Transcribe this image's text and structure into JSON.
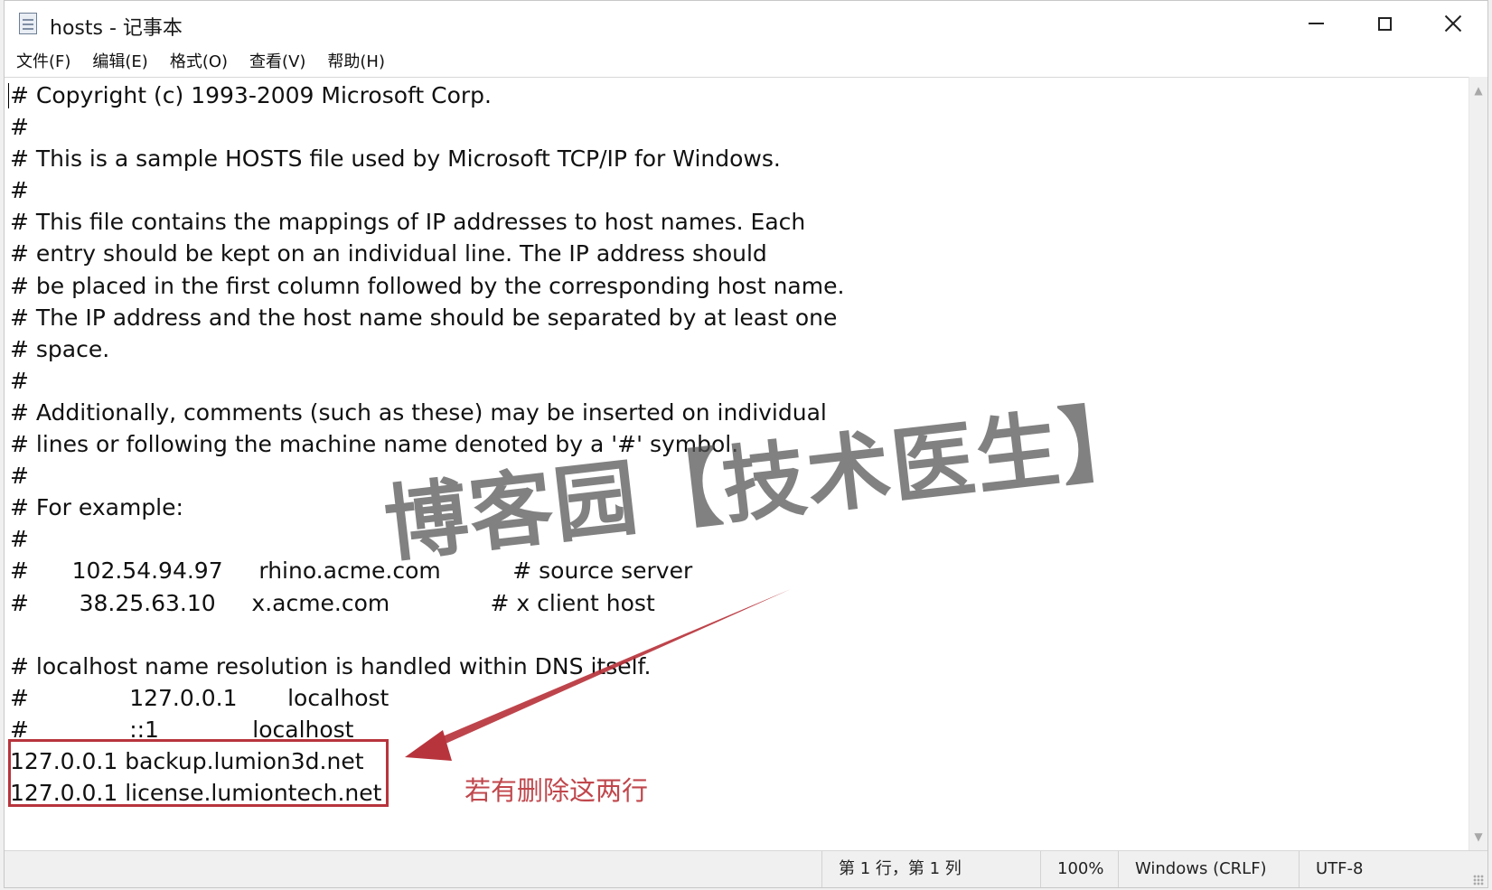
{
  "window": {
    "title": "hosts - 记事本",
    "controls": {
      "minimize": "minimize",
      "maximize": "maximize",
      "close": "close"
    }
  },
  "menu": [
    {
      "label": "文件(F)"
    },
    {
      "label": "编辑(E)"
    },
    {
      "label": "格式(O)"
    },
    {
      "label": "查看(V)"
    },
    {
      "label": "帮助(H)"
    }
  ],
  "editor": {
    "lines": [
      "# Copyright (c) 1993-2009 Microsoft Corp.",
      "#",
      "# This is a sample HOSTS file used by Microsoft TCP/IP for Windows.",
      "#",
      "# This file contains the mappings of IP addresses to host names. Each",
      "# entry should be kept on an individual line. The IP address should",
      "# be placed in the first column followed by the corresponding host name.",
      "# The IP address and the host name should be separated by at least one",
      "# space.",
      "#",
      "# Additionally, comments (such as these) may be inserted on individual",
      "# lines or following the machine name denoted by a '#' symbol.",
      "#",
      "# For example:",
      "#",
      "#      102.54.94.97     rhino.acme.com          # source server",
      "#       38.25.63.10     x.acme.com              # x client host",
      "",
      "# localhost name resolution is handled within DNS itself.",
      "#              127.0.0.1       localhost",
      "#              ::1             localhost",
      "127.0.0.1 backup.lumion3d.net",
      "127.0.0.1 license.lumiontech.net"
    ]
  },
  "statusbar": {
    "position": "第 1 行，第 1 列",
    "zoom": "100%",
    "line_ending": "Windows (CRLF)",
    "encoding": "UTF-8"
  },
  "annotation": {
    "note": "若有删除这两行",
    "color": "#b8343c"
  },
  "watermark": {
    "text": "博客园【技术医生】"
  },
  "icons": {
    "app": "notepad-icon",
    "scroll_up": "scroll-up-arrow-icon",
    "scroll_down": "scroll-down-arrow-icon",
    "grip": "resize-grip-icon"
  }
}
